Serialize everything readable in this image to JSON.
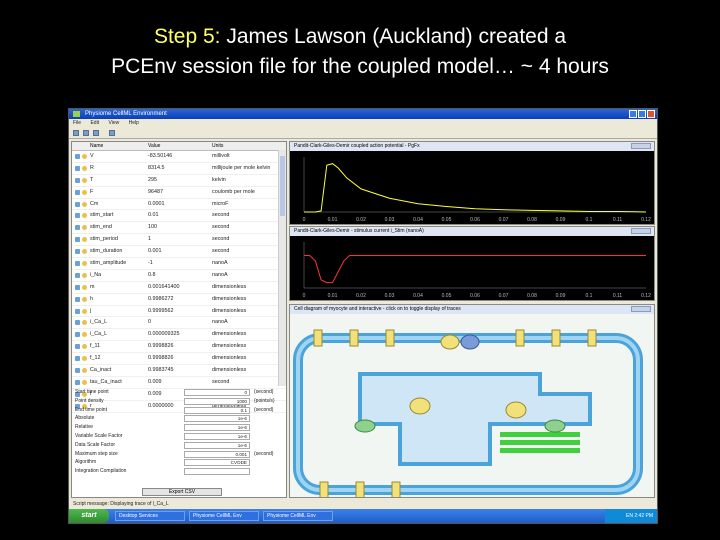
{
  "slide": {
    "title_step": "Step 5:",
    "title_line1_rest": " James Lawson (Auckland) created a",
    "title_line2": "PCEnv session file for the coupled model… ~ 4 hours"
  },
  "app": {
    "window_title": "Physiome CellML Environment",
    "menu": [
      "File",
      "Edit",
      "View",
      "Help"
    ],
    "status_message": "Script message: Displaying trace of l_Ca_L",
    "table": {
      "columns": [
        "Name",
        "Value",
        "Units"
      ],
      "rows": [
        {
          "name": "V",
          "value": "-83.50146",
          "units": "millivolt"
        },
        {
          "name": "R",
          "value": "8314.5",
          "units": "millijoule per mole kelvin"
        },
        {
          "name": "T",
          "value": "295",
          "units": "kelvin"
        },
        {
          "name": "F",
          "value": "96487",
          "units": "coulomb per mole"
        },
        {
          "name": "Cm",
          "value": "0.0001",
          "units": "microF"
        },
        {
          "name": "stim_start",
          "value": "0.01",
          "units": "second"
        },
        {
          "name": "stim_end",
          "value": "100",
          "units": "second"
        },
        {
          "name": "stim_period",
          "value": "1",
          "units": "second"
        },
        {
          "name": "stim_duration",
          "value": "0.001",
          "units": "second"
        },
        {
          "name": "stim_amplitude",
          "value": "-1",
          "units": "nanoA"
        },
        {
          "name": "i_Na",
          "value": "0.8",
          "units": "nanoA"
        },
        {
          "name": "m",
          "value": "0.001641400",
          "units": "dimensionless"
        },
        {
          "name": "h",
          "value": "0.9986272",
          "units": "dimensionless"
        },
        {
          "name": "j",
          "value": "0.9999562",
          "units": "dimensionless"
        },
        {
          "name": "i_Ca_L",
          "value": "0",
          "units": "nanoA"
        },
        {
          "name": "i_Ca_L",
          "value": "0.000009325",
          "units": "dimensionless"
        },
        {
          "name": "f_11",
          "value": "0.9998826",
          "units": "dimensionless"
        },
        {
          "name": "f_12",
          "value": "0.9998826",
          "units": "dimensionless"
        },
        {
          "name": "Ca_inact",
          "value": "0.9983745",
          "units": "dimensionless"
        },
        {
          "name": "tau_Ca_inact",
          "value": "0.009",
          "units": "second"
        },
        {
          "name": "f",
          "value": "0.009",
          "units": "micros"
        },
        {
          "name": "r",
          "value": "0.0000000",
          "units": "dimensionless"
        }
      ]
    },
    "params": [
      {
        "label": "Start time point",
        "value": "0",
        "unit": "(second)"
      },
      {
        "label": "Point density",
        "value": "1000",
        "unit": "(points/s)"
      },
      {
        "label": "End time point",
        "value": "0.1",
        "unit": "(second)"
      },
      {
        "label": "Absolute",
        "value": "1e-6",
        "unit": ""
      },
      {
        "label": "Relative",
        "value": "1e-6",
        "unit": ""
      },
      {
        "label": "Variable Scale Factor",
        "value": "1e-6",
        "unit": ""
      },
      {
        "label": "Data Scale Factor",
        "value": "1e-6",
        "unit": ""
      },
      {
        "label": "Maximum step size",
        "value": "0.001",
        "unit": "(second)"
      },
      {
        "label": "Algorithm",
        "value": "CVODE",
        "unit": ""
      },
      {
        "label": "Integration Compilation",
        "value": "",
        "unit": ""
      }
    ],
    "export_button": "Export CSV",
    "panels": {
      "plot1_title": "Pandit-Clark-Giles-Demir coupled action potential - PgFx",
      "plot2_title": "Pandit-Clark-Giles-Demir - stimulus current i_Stim (nanoA)",
      "diagram_title": "Cell diagram of myocyte and interactive - click on to toggle display of traces"
    },
    "taskbar": {
      "start": "start",
      "tasks": [
        "Desktop Services",
        "Physiome CellML Env",
        "Physiome CellML Env"
      ],
      "clock": "EN 2:42 PM"
    }
  },
  "chart_data": [
    {
      "type": "line",
      "title": "",
      "x": [
        0,
        0.004,
        0.006,
        0.008,
        0.01,
        0.012,
        0.015,
        0.02,
        0.03,
        0.04,
        0.05,
        0.06,
        0.07,
        0.08,
        0.09,
        0.1,
        0.11,
        0.12
      ],
      "y": [
        0,
        0,
        0.02,
        0.85,
        0.88,
        0.8,
        0.62,
        0.42,
        0.25,
        0.15,
        0.1,
        0.06,
        0.04,
        0.03,
        0.02,
        0.01,
        0.01,
        0
      ],
      "xlim": [
        0,
        0.12
      ],
      "ylim": [
        0,
        1
      ],
      "xticks": [
        "0",
        "0.01",
        "0.02",
        "0.03",
        "0.04",
        "0.05",
        "0.06",
        "0.07",
        "0.08",
        "0.09",
        "0.1",
        "0.11",
        "0.12"
      ],
      "color": "#ffff33"
    },
    {
      "type": "line",
      "title": "",
      "x": [
        0,
        0.002,
        0.004,
        0.006,
        0.008,
        0.01,
        0.012,
        0.014,
        0.016,
        0.02,
        0.03,
        0.05,
        0.08,
        0.1,
        0.12
      ],
      "y": [
        0,
        0,
        -0.2,
        -0.9,
        -1.0,
        -1.0,
        -0.6,
        -0.2,
        0,
        0,
        0,
        0,
        0,
        0,
        0
      ],
      "xlim": [
        0,
        0.12
      ],
      "ylim": [
        -1.2,
        0.5
      ],
      "xticks": [
        "0",
        "0.01",
        "0.02",
        "0.03",
        "0.04",
        "0.05",
        "0.06",
        "0.07",
        "0.08",
        "0.09",
        "0.1",
        "0.11",
        "0.12"
      ],
      "color": "#ff3333"
    }
  ]
}
